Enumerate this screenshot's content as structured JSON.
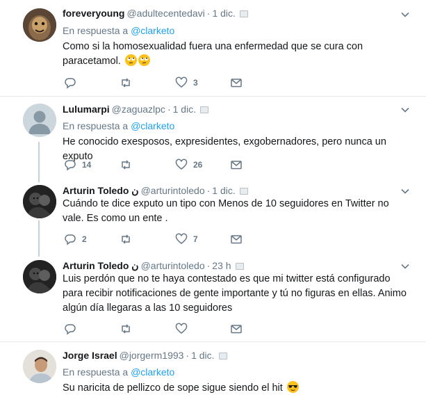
{
  "reply_prefix": "En respuesta a",
  "tweets": [
    {
      "name": "foreveryoung",
      "handle": "@adultecentedavi",
      "time": "1 dic.",
      "reply_to": "@clarketo",
      "text": "Como si la homosexualidad fuera una enfermedad que se cura con paracetamol.",
      "replies": "",
      "retweets": "",
      "likes": "3"
    },
    {
      "name": "Lulumarpi",
      "handle": "@zaguazlpc",
      "time": "1 dic.",
      "reply_to": "@clarketo",
      "text": "He conocido exesposos, expresidentes, exgobernadores, pero nunca un exputo",
      "replies": "14",
      "retweets": "",
      "likes": "26"
    },
    {
      "name": "Arturin Toledo ن",
      "handle": "@arturintoledo",
      "time": "1 dic.",
      "text": "Cuándo te dice exputo un tipo con Menos de 10 seguidores en Twitter no vale. Es como un ente .",
      "replies": "2",
      "retweets": "",
      "likes": "7"
    },
    {
      "name": "Arturin Toledo ن",
      "handle": "@arturintoledo",
      "time": "23 h",
      "text": "Luis perdón que no te haya contestado es que mi twitter está configurado para recibir notificaciones de gente importante y tú no figuras en ellas. Animo algún día llegaras a las 10 seguidores",
      "replies": "",
      "retweets": "",
      "likes": ""
    },
    {
      "name": "Jorge Israel",
      "handle": "@jorgerm1993",
      "time": "1 dic.",
      "reply_to": "@clarketo",
      "text": "Su naricita de pellizco de sope sigue siendo el hit"
    }
  ],
  "colors": {
    "link": "#1da1f2",
    "muted": "#657786",
    "thread": "#c4cfd6",
    "divider": "#e6ecf0"
  },
  "icons": [
    "reply-icon",
    "retweet-icon",
    "like-icon",
    "message-icon",
    "chevron-down-icon",
    "rolling-eyes-emoji",
    "sunglasses-emoji"
  ]
}
